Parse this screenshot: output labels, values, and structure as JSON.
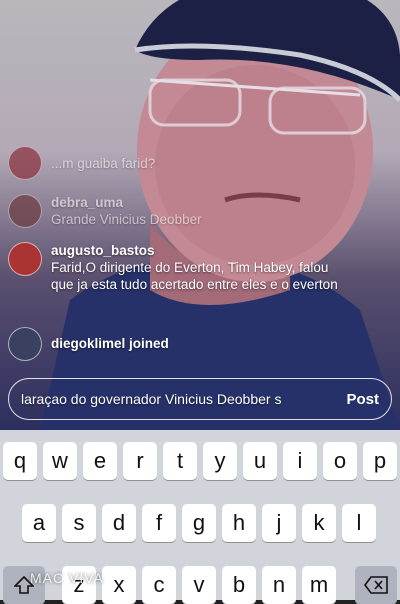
{
  "comments": [
    {
      "user": "",
      "text": "...m guaiba farid?"
    },
    {
      "user": "debra_uma",
      "text": "Grande Vinicius Deobber"
    },
    {
      "user": "augusto_bastos",
      "text": "Farid,O dirigente do Everton, Tim Habey, falou que ja esta tudo acertado entre eles e o everton"
    },
    {
      "user": "diegoklimel joined",
      "text": ""
    }
  ],
  "input": {
    "value": "laraçao do governador Vinicius Deobber s",
    "post_label": "Post"
  },
  "keyboard": {
    "row1": [
      "q",
      "w",
      "e",
      "r",
      "t",
      "y",
      "u",
      "i",
      "o",
      "p"
    ],
    "row2": [
      "a",
      "s",
      "d",
      "f",
      "g",
      "h",
      "j",
      "k",
      "l"
    ],
    "row3": [
      "z",
      "x",
      "c",
      "v",
      "b",
      "n",
      "m"
    ],
    "shift_icon": "shift-arrow-icon",
    "delete_icon": "backspace-icon"
  },
  "watermark": "MAC VIVA"
}
